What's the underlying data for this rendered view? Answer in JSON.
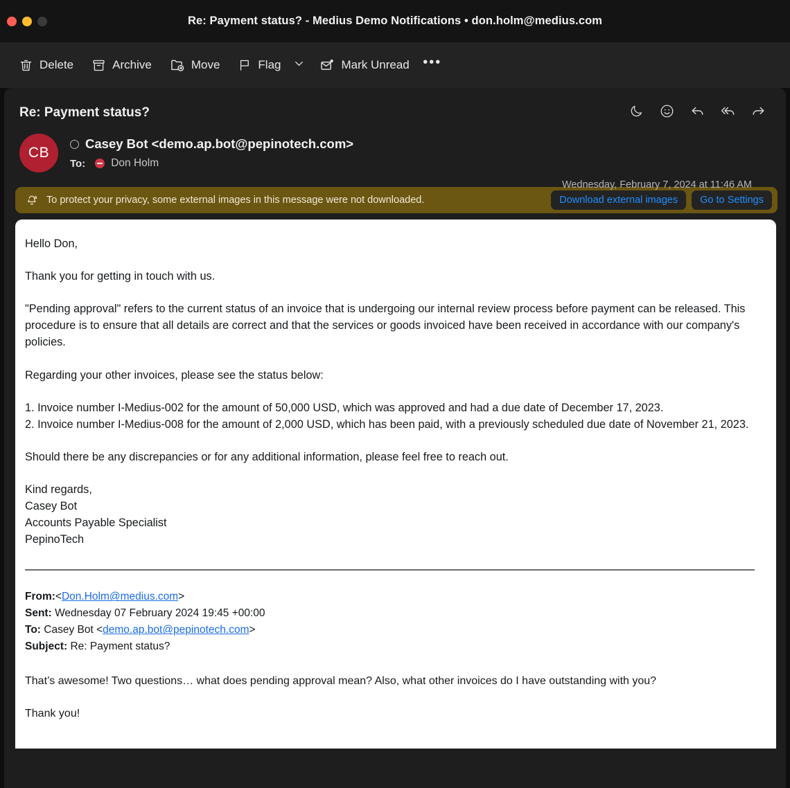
{
  "window": {
    "title": "Re: Payment status? - Medius Demo Notifications • don.holm@medius.com",
    "traffic_lights": [
      "close",
      "minimize",
      "zoom"
    ]
  },
  "toolbar": {
    "items": [
      {
        "label": "Delete",
        "icon": "trash-icon"
      },
      {
        "label": "Archive",
        "icon": "archive-box-icon"
      },
      {
        "label": "Move",
        "icon": "folder-move-icon"
      },
      {
        "label": "Flag",
        "icon": "flag-icon"
      },
      {
        "label": "Mark Unread",
        "icon": "envelope-badge-icon"
      }
    ],
    "flag_chevron": "chevron-down-icon",
    "more_label": "•••"
  },
  "message": {
    "subject": "Re: Payment status?",
    "avatar_initials": "CB",
    "sender": "Casey Bot <demo.ap.bot@pepinotech.com>",
    "to_label": "To:",
    "to_name": "Don Holm",
    "timestamp": "Wednesday, February 7, 2024 at 11:46 AM",
    "header_actions": [
      {
        "name": "snooze-icon",
        "glyph": "moon"
      },
      {
        "name": "react-icon",
        "glyph": "smiley"
      },
      {
        "name": "reply-icon",
        "glyph": "reply"
      },
      {
        "name": "reply-all-icon",
        "glyph": "reply-all"
      },
      {
        "name": "forward-icon",
        "glyph": "forward"
      }
    ]
  },
  "privacy_banner": {
    "icon": "bell-slash-icon",
    "text": "To protect your privacy, some external images in this message were not downloaded.",
    "download_label": "Download external images",
    "settings_label": "Go to Settings",
    "background_color": "#6b5612",
    "link_color": "#1f8fff"
  },
  "body": {
    "greeting": "Hello Don,",
    "paragraph_1": "Thank you for getting in touch with us.",
    "paragraph_2": "\"Pending approval\" refers to the current status of an invoice that is undergoing our internal review process before payment can be released. This procedure is to ensure that all details are correct and that the services or goods invoiced have been received in accordance with our company's policies.",
    "paragraph_3": "Regarding your other invoices, please see the status below:",
    "list_item_1": "1. Invoice number I-Medius-002 for the amount of 50,000 USD, which was approved and had a due date of December 17, 2023.",
    "list_item_2": "2. Invoice number I-Medius-008 for the amount of 2,000 USD, which has been paid, with a previously scheduled due date of November 21, 2023.",
    "paragraph_4": "Should there be any discrepancies or for any additional information, please feel free to reach out.",
    "signature": [
      "Kind regards,",
      "Casey Bot",
      "Accounts Payable Specialist",
      "PepinoTech"
    ]
  },
  "quoted": {
    "from_label": "From:",
    "from_bracket_open": "<",
    "from_email": "Don.Holm@medius.com",
    "from_bracket_close": ">",
    "sent_label": "Sent:",
    "sent_value": "Wednesday 07 February 2024 19:45 +00:00",
    "to_label": "To:",
    "to_value_prefix": "Casey Bot <",
    "to_email": "demo.ap.bot@pepinotech.com",
    "to_value_suffix": ">",
    "subject_label": "Subject:",
    "subject_value": "Re: Payment status?",
    "message_1": "That’s awesome! Two questions… what does pending approval mean?  Also, what other invoices do I have outstanding with you?",
    "message_2": "Thank you!"
  }
}
